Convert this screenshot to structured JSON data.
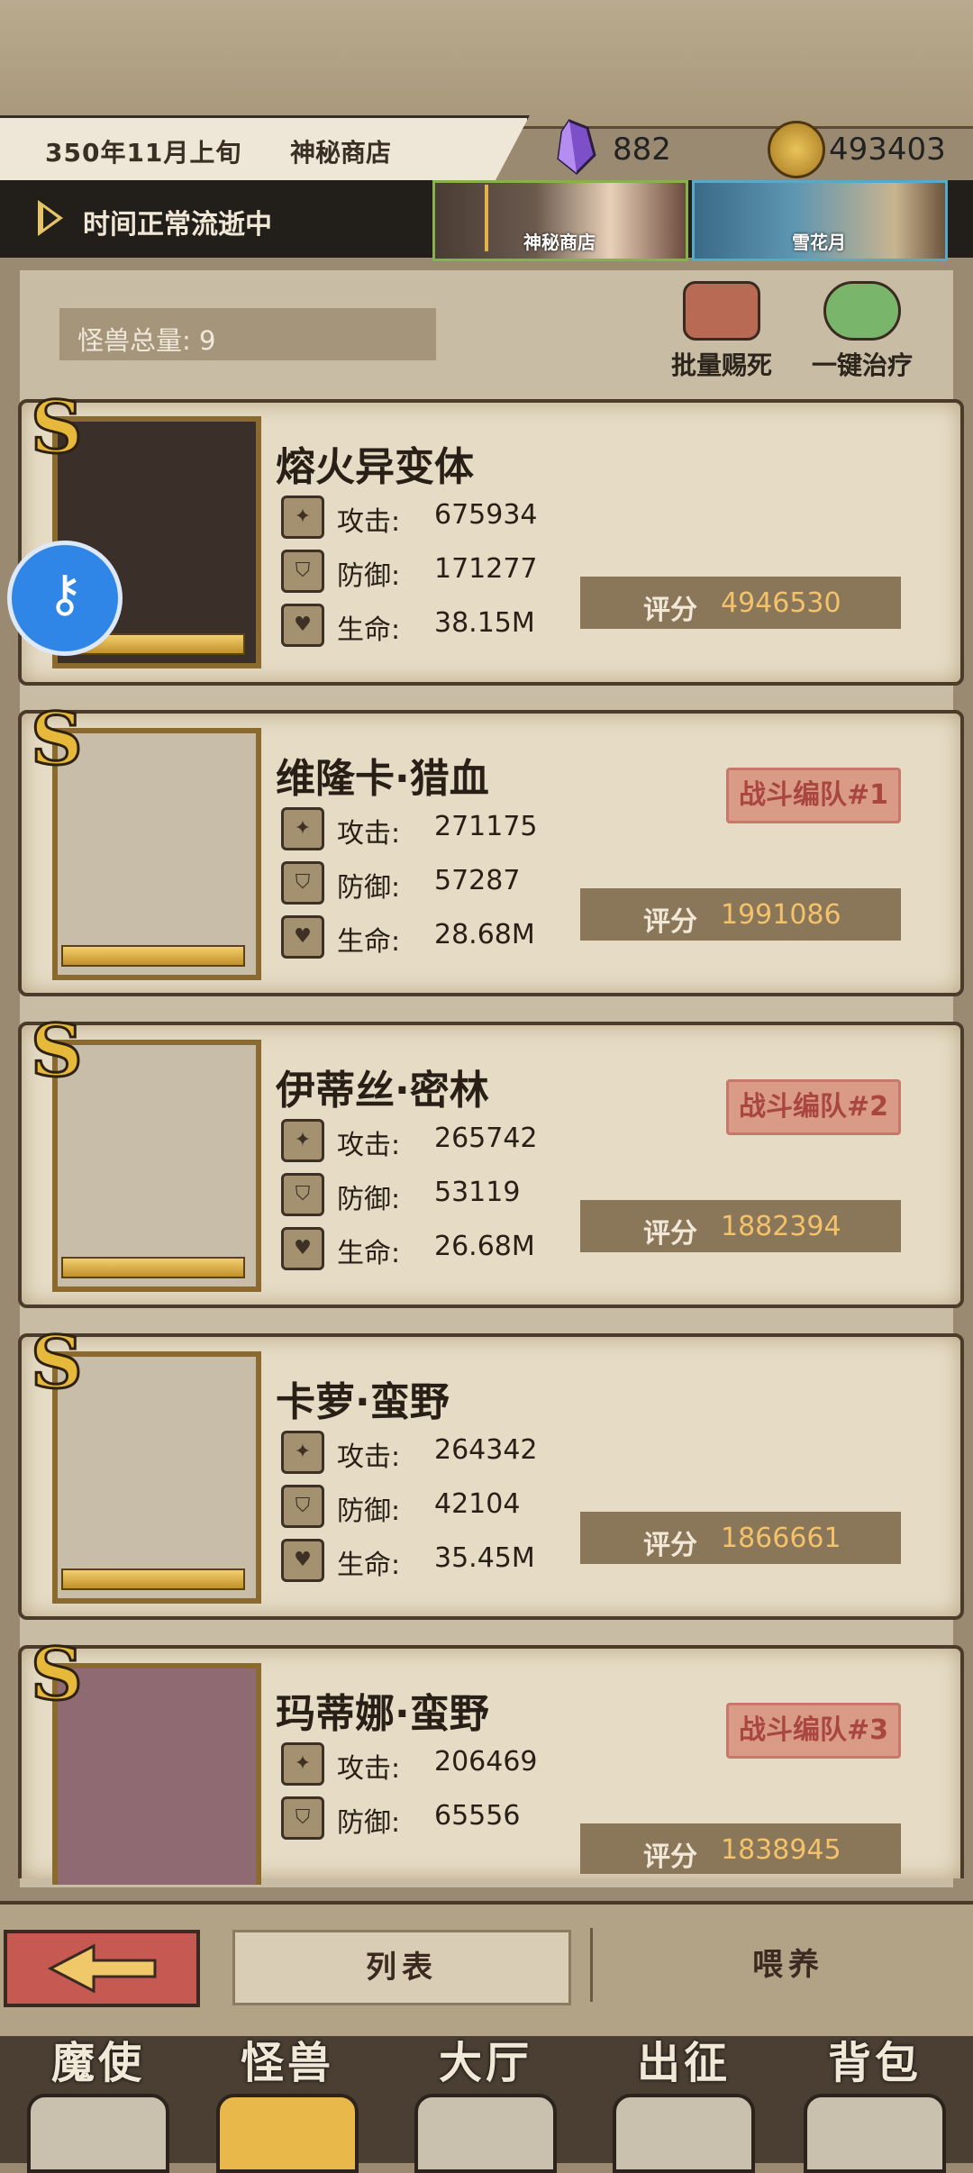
{
  "header": {
    "date": "350年11月上旬",
    "location": "神秘商店",
    "crystal_count": "882",
    "gold_count": "493403"
  },
  "time": {
    "status": "时间正常流逝中"
  },
  "events": [
    {
      "label": "神秘商店"
    },
    {
      "label": "雪花月"
    }
  ],
  "monsters_panel": {
    "total_label": "怪兽总量: 9",
    "batch_kill": "批量赐死",
    "heal_all": "一键治疗"
  },
  "stat_labels": {
    "attack": "攻击:",
    "defense": "防御:",
    "hp": "生命:",
    "score": "评分"
  },
  "cards": [
    {
      "name": "熔火异变体",
      "attack": "675934",
      "defense": "171277",
      "hp": "38.15M",
      "score": "4946530",
      "team": ""
    },
    {
      "name": "维隆卡·猎血",
      "attack": "271175",
      "defense": "57287",
      "hp": "28.68M",
      "score": "1991086",
      "team": "战斗编队#1"
    },
    {
      "name": "伊蒂丝·密林",
      "attack": "265742",
      "defense": "53119",
      "hp": "26.68M",
      "score": "1882394",
      "team": "战斗编队#2"
    },
    {
      "name": "卡萝·蛮野",
      "attack": "264342",
      "defense": "42104",
      "hp": "35.45M",
      "score": "1866661",
      "team": ""
    },
    {
      "name": "玛蒂娜·蛮野",
      "attack": "206469",
      "defense": "65556",
      "hp": "",
      "score": "1838945",
      "team": "战斗编队#3"
    }
  ],
  "tabs": {
    "list": "列表",
    "feed": "喂养"
  },
  "nav": [
    {
      "label": "魔使"
    },
    {
      "label": "怪兽"
    },
    {
      "label": "大厅"
    },
    {
      "label": "出征"
    },
    {
      "label": "背包"
    }
  ],
  "colors": {
    "accent_gold": "#e5c367",
    "score_value": "#f3c26a",
    "team_badge": "#d99a86"
  }
}
